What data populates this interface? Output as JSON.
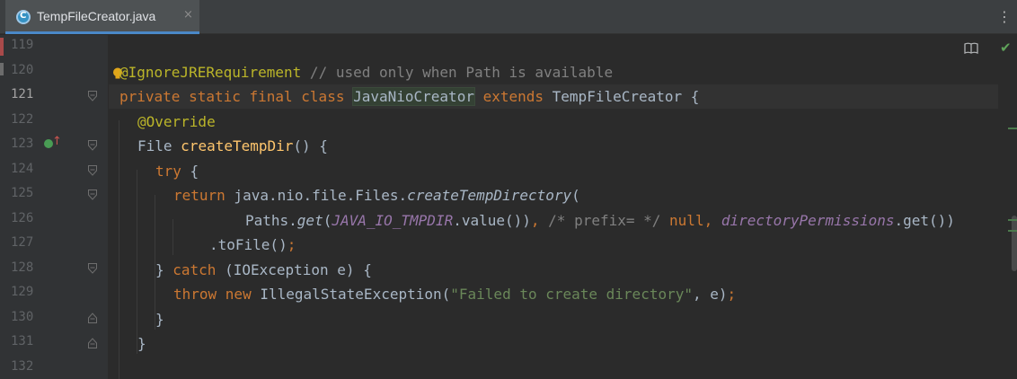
{
  "tab": {
    "title": "TempFileCreator.java",
    "close": "×"
  },
  "menu": {
    "more": "⋮"
  },
  "gutter": {
    "lines": [
      "119",
      "120",
      "121",
      "122",
      "123",
      "124",
      "125",
      "126",
      "127",
      "128",
      "129",
      "130",
      "131",
      "132"
    ]
  },
  "code": {
    "l120_ann": "@IgnoreJRERequirement",
    "l120_cmt": " // used only when Path is available",
    "l121_kw": "private static final class ",
    "l121_cls": "JavaNioCreator",
    "l121_kw2": " extends ",
    "l121_rest": "TempFileCreator {",
    "l122_ann": "@Override",
    "l123_type": "File ",
    "l123_fn": "createTempDir",
    "l123_rest": "() {",
    "l124_kw": "try",
    "l124_rest": " {",
    "l125_kw": "return",
    "l125_rest": " java.nio.file.Files.",
    "l125_fn": "createTempDirectory",
    "l125_end": "(",
    "l126_a": "Paths.",
    "l126_get": "get",
    "l126_b": "(",
    "l126_const": "JAVA_IO_TMPDIR",
    "l126_c": ".value())",
    "l126_comma": ", ",
    "l126_cmt": "/* prefix= */",
    "l126_null": " null, ",
    "l126_perm": "directoryPermissions",
    "l126_d": ".get())",
    "l127_a": ".toFile()",
    "l127_semi": ";",
    "l128_a": "} ",
    "l128_kw": "catch",
    "l128_rest": " (IOException e) {",
    "l129_kw": "throw new",
    "l129_a": " IllegalStateException(",
    "l129_str": "\"Failed to create directory\"",
    "l129_b": ", e)",
    "l129_semi": ";",
    "l130": "}",
    "l131": "}"
  },
  "icons": {
    "file": "java-class-icon",
    "bulb": "lightbulb-icon",
    "reader": "reader-mode-icon",
    "check": "inspection-ok-icon",
    "override": "overrides-method-icon"
  },
  "status": {
    "check": "✔"
  },
  "colors": {
    "keyword": "#cc7832",
    "annotation": "#bbb529",
    "comment": "#808080",
    "function": "#ffc66d",
    "string": "#6a8759",
    "constant": "#9876aa",
    "text": "#a9b7c6",
    "background": "#2b2b2b"
  }
}
